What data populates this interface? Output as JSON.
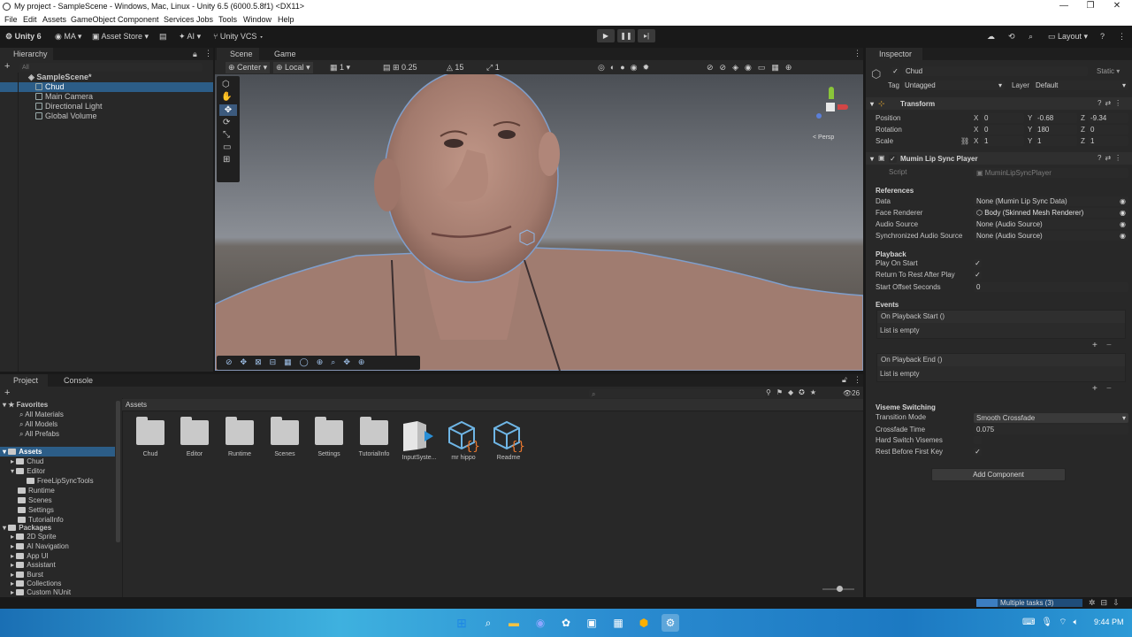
{
  "window": {
    "title": "My project - SampleScene - Windows, Mac, Linux - Unity 6.5 (6000.5.8f1) <DX11>"
  },
  "menu": [
    "File",
    "Edit",
    "Assets",
    "GameObject",
    "Component",
    "Services",
    "Jobs",
    "Tools",
    "Window",
    "Help"
  ],
  "toolbar": {
    "unity": "Unity 6",
    "account": "MA",
    "asset_store": "Asset Store",
    "ai": "AI",
    "vcs": "Unity VCS",
    "layout": "Layout"
  },
  "hierarchy": {
    "tab": "Hierarchy",
    "search_placeholder": "All",
    "scene": "SampleScene*",
    "items": [
      "Chud",
      "Main Camera",
      "Directional Light",
      "Global Volume"
    ]
  },
  "scene_view": {
    "tabs": [
      "Scene",
      "Game"
    ],
    "pivot": "Center",
    "space": "Local",
    "grid": "1",
    "snap_value": "0.25",
    "rotate_snap": "15",
    "scale_snap": "1",
    "persp": "< Persp"
  },
  "project": {
    "tabs": [
      "Project",
      "Console"
    ],
    "breadcrumb": "Assets",
    "count": "26",
    "favorites_label": "Favorites",
    "favorites": [
      "All Materials",
      "All Models",
      "All Prefabs"
    ],
    "assets_label": "Assets",
    "asset_tree": [
      "Chud",
      "Editor",
      "FreeLipSyncTools",
      "Runtime",
      "Scenes",
      "Settings",
      "TutorialInfo"
    ],
    "packages_label": "Packages",
    "packages": [
      "2D Sprite",
      "AI Navigation",
      "App UI",
      "Assistant",
      "Burst",
      "Collections",
      "Custom NUnit"
    ],
    "grid_items": [
      "Chud",
      "Editor",
      "Runtime",
      "Scenes",
      "Settings",
      "TutorialInfo",
      "InputSyste...",
      "mr hippo",
      "Readme"
    ]
  },
  "inspector": {
    "tab": "Inspector",
    "object_name": "Chud",
    "static": "Static",
    "tag_label": "Tag",
    "tag": "Untagged",
    "layer_label": "Layer",
    "layer": "Default",
    "transform": {
      "title": "Transform",
      "position_label": "Position",
      "rotation_label": "Rotation",
      "scale_label": "Scale",
      "position": {
        "x": "0",
        "y": "-0.68",
        "z": "-9.34"
      },
      "rotation": {
        "x": "0",
        "y": "180",
        "z": "0"
      },
      "scale": {
        "x": "1",
        "y": "1",
        "z": "1"
      }
    },
    "component": {
      "title": "Mumin Lip Sync Player",
      "script_label": "Script",
      "script": "MuminLipSyncPlayer",
      "references_label": "References",
      "data_label": "Data",
      "data": "None (Mumin Lip Sync Data)",
      "face_label": "Face Renderer",
      "face": "Body (Skinned Mesh Renderer)",
      "audio_label": "Audio Source",
      "audio": "None (Audio Source)",
      "sync_label": "Synchronized Audio Source",
      "sync": "None (Audio Source)",
      "playback_label": "Playback",
      "play_on_start": "Play On Start",
      "return_to_rest": "Return To Rest After Play",
      "start_offset_label": "Start Offset Seconds",
      "start_offset": "0",
      "events_label": "Events",
      "event_start": "On Playback Start ()",
      "event_end": "On Playback End ()",
      "list_empty": "List is empty",
      "viseme_label": "Viseme Switching",
      "transition_label": "Transition Mode",
      "transition": "Smooth Crossfade",
      "crossfade_label": "Crossfade Time",
      "crossfade": "0.075",
      "hard_switch": "Hard Switch Visemes",
      "rest_before": "Rest Before First Key"
    },
    "add_component": "Add Component"
  },
  "status": {
    "tasks": "Multiple tasks (3)"
  },
  "taskbar": {
    "time": "9:44 PM"
  }
}
